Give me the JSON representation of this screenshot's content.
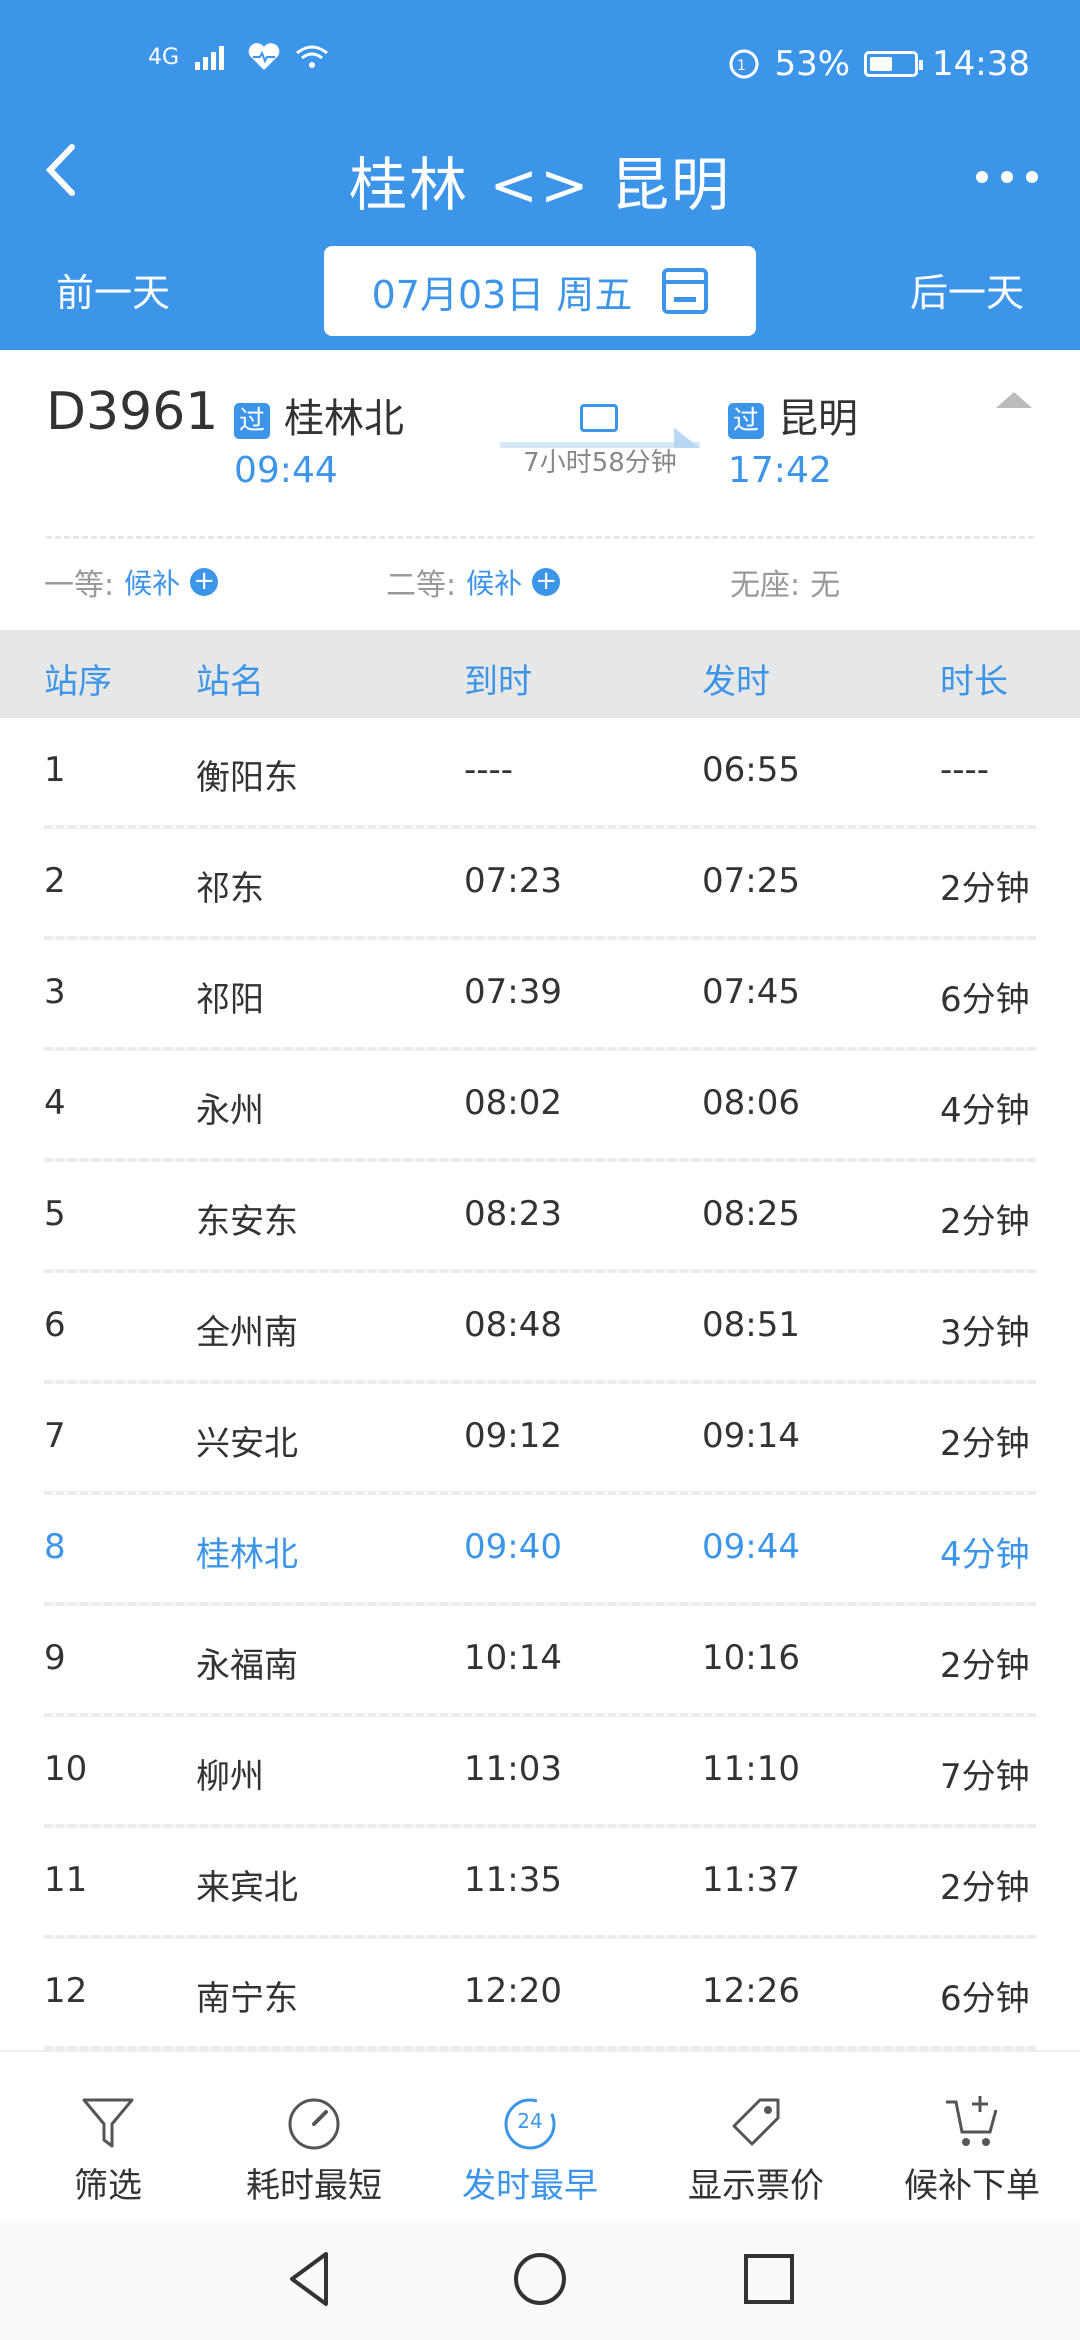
{
  "status": {
    "network": "4G",
    "battery": "53%",
    "time": "14:38",
    "icons": [
      "signal-icon",
      "health-icon",
      "wifi-icon",
      "nfc-icon",
      "battery-icon"
    ]
  },
  "header": {
    "title": "桂林 <> 昆明",
    "prev_day": "前一天",
    "next_day": "后一天",
    "date": "07月03日 周五"
  },
  "train": {
    "number": "D3961",
    "from_badge": "过",
    "from_station": "桂林北",
    "from_time": "09:44",
    "to_badge": "过",
    "to_station": "昆明",
    "to_time": "17:42",
    "duration": "7小时58分钟",
    "seats": [
      {
        "label": "一等:",
        "value": "候补",
        "has_plus": true
      },
      {
        "label": "二等:",
        "value": "候补",
        "has_plus": true
      },
      {
        "label": "无座:",
        "value": "无",
        "has_plus": false
      }
    ]
  },
  "table": {
    "headers": [
      "站序",
      "站名",
      "到时",
      "发时",
      "时长"
    ],
    "rows": [
      [
        "1",
        "衡阳东",
        "----",
        "06:55",
        "----"
      ],
      [
        "2",
        "祁东",
        "07:23",
        "07:25",
        "2分钟"
      ],
      [
        "3",
        "祁阳",
        "07:39",
        "07:45",
        "6分钟"
      ],
      [
        "4",
        "永州",
        "08:02",
        "08:06",
        "4分钟"
      ],
      [
        "5",
        "东安东",
        "08:23",
        "08:25",
        "2分钟"
      ],
      [
        "6",
        "全州南",
        "08:48",
        "08:51",
        "3分钟"
      ],
      [
        "7",
        "兴安北",
        "09:12",
        "09:14",
        "2分钟"
      ],
      [
        "8",
        "桂林北",
        "09:40",
        "09:44",
        "4分钟"
      ],
      [
        "9",
        "永福南",
        "10:14",
        "10:16",
        "2分钟"
      ],
      [
        "10",
        "柳州",
        "11:03",
        "11:10",
        "7分钟"
      ],
      [
        "11",
        "来宾北",
        "11:35",
        "11:37",
        "2分钟"
      ],
      [
        "12",
        "南宁东",
        "12:20",
        "12:26",
        "6分钟"
      ]
    ],
    "highlight_row": 8
  },
  "bottom": {
    "filter": "筛选",
    "shortest": "耗时最短",
    "earliest": "发时最早",
    "earliest_badge": "24",
    "price": "显示票价",
    "waitlist": "候补下单"
  },
  "colors": {
    "accent": "#3d95ea"
  }
}
